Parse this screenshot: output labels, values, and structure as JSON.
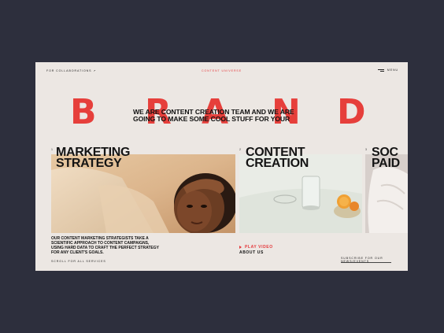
{
  "topbar": {
    "collab_label": "FOR COLLABORATIONS ↗",
    "center_title": "CONTENT UNIVERSE",
    "menu_label": "MENU"
  },
  "brand": {
    "letters": [
      "B",
      "R",
      "A",
      "N",
      "D"
    ],
    "tagline": "WE ARE CONTENT CREATION TEAM AND WE ARE GOING TO MAKE SOME COOL STUFF FOR YOUR"
  },
  "services": [
    {
      "num": "1",
      "title_line1": "MARKETING",
      "title_line2": "STRATEGY"
    },
    {
      "num": "2",
      "title_line1": "CONTENT",
      "title_line2": "CREATION"
    },
    {
      "num": "3",
      "title_line1": "SOC",
      "title_line2": "PAID"
    }
  ],
  "strategy": {
    "description": "OUR CONTENT MARKETING STRATEGISTS TAKE A SCIENTIFIC APPROACH TO CONTENT CAMPAIGNS, USING HARD DATA TO CRAFT THE PERFECT STRATEGY FOR ANY CLIENT'S GOALS.",
    "scroll_label": "SCROLL FOR ALL SERVICES"
  },
  "creation": {
    "play_label": "PLAY VIDEO",
    "about_label": "ABOUT US"
  },
  "subscribe_label": "SUBSCRIBE FOR OUR NEWS/EVENTS",
  "colors": {
    "background": "#2d2f3d",
    "card": "#ece7e3",
    "accent": "#e5383b"
  }
}
